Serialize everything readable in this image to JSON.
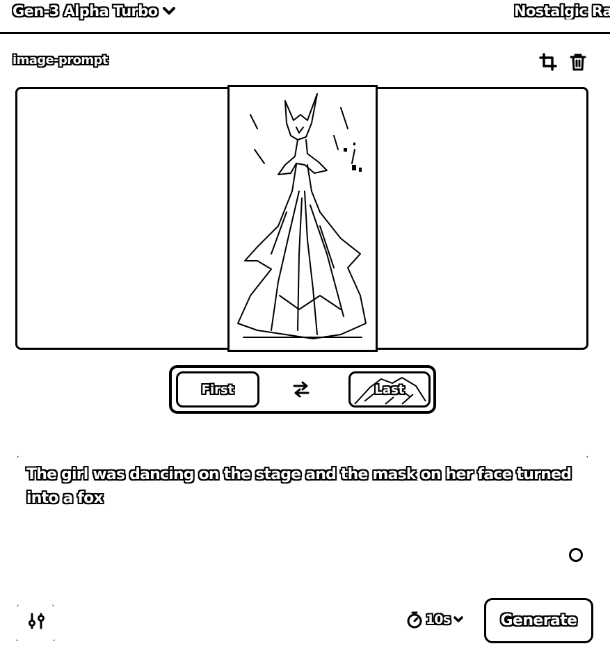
{
  "header": {
    "model_name": "Gen-3 Alpha Turbo",
    "style_preset": "Nostalgic Ra"
  },
  "image_prompt": {
    "label": "image-prompt",
    "keyframes": {
      "first_label": "First",
      "last_label": "Last"
    }
  },
  "prompt": {
    "text": "The girl was dancing on the stage and the mask on her face turned into a fox"
  },
  "footer": {
    "duration": "10s",
    "generate_label": "Generate"
  },
  "icons": [
    "chevron-down-icon",
    "crop-icon",
    "trash-icon",
    "swap-icon",
    "circle-icon",
    "settings-icon",
    "timer-icon"
  ]
}
